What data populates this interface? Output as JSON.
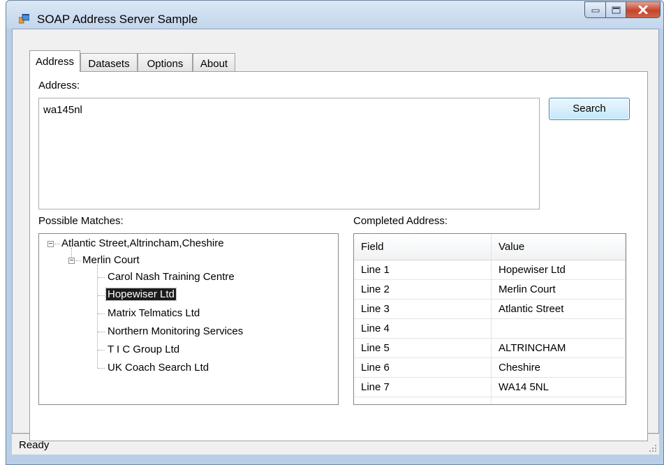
{
  "window": {
    "title": "SOAP Address Server Sample",
    "status": "Ready"
  },
  "tabs": [
    "Address",
    "Datasets",
    "Options",
    "About"
  ],
  "address": {
    "label": "Address:",
    "value": "wa145nl",
    "search_button": "Search"
  },
  "matches": {
    "label": "Possible Matches:",
    "root": "Atlantic Street,Altrincham,Cheshire",
    "child": "Merlin Court",
    "leaves": [
      "Carol Nash Training Centre",
      "Hopewiser Ltd",
      "Matrix Telmatics Ltd",
      "Northern Monitoring Services",
      "T I C Group Ltd",
      "UK Coach Search Ltd"
    ],
    "selected_leaf": "Hopewiser Ltd"
  },
  "completed": {
    "label": "Completed Address:",
    "columns": [
      "Field",
      "Value"
    ],
    "rows": [
      [
        "Line 1",
        "Hopewiser Ltd"
      ],
      [
        "Line 2",
        "Merlin Court"
      ],
      [
        "Line 3",
        "Atlantic Street"
      ],
      [
        "Line 4",
        ""
      ],
      [
        "Line 5",
        "ALTRINCHAM"
      ],
      [
        "Line 6",
        "Cheshire"
      ],
      [
        "Line 7",
        "WA14 5NL"
      ]
    ]
  },
  "icons": {
    "app": "app-window-icon",
    "minimize": "minimize-icon",
    "maximize": "maximize-icon",
    "close": "close-icon",
    "grip": "resize-grip-icon"
  },
  "colors": {
    "frame": "#b8cfe7",
    "close_button": "#c4442c",
    "selection": "#1c1c1c"
  }
}
